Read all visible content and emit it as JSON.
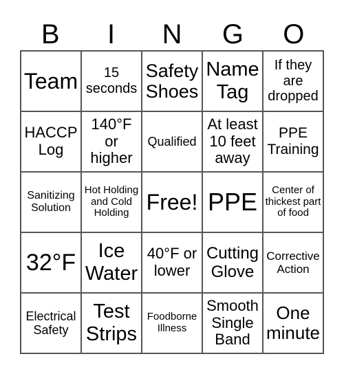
{
  "header": [
    "B",
    "I",
    "N",
    "G",
    "O"
  ],
  "cells": [
    {
      "text": "Team",
      "size": 32
    },
    {
      "text": "15 seconds",
      "size": 20
    },
    {
      "text": "Safety Shoes",
      "size": 27
    },
    {
      "text": "Name Tag",
      "size": 29
    },
    {
      "text": "If they are dropped",
      "size": 20
    },
    {
      "text": "HACCP Log",
      "size": 22
    },
    {
      "text": "140°F or higher",
      "size": 22
    },
    {
      "text": "Qualified",
      "size": 18
    },
    {
      "text": "At least 10 feet away",
      "size": 22
    },
    {
      "text": "PPE Training",
      "size": 21
    },
    {
      "text": "Sanitizing Solution",
      "size": 16
    },
    {
      "text": "Hot Holding and Cold Holding",
      "size": 15
    },
    {
      "text": "Free!",
      "size": 32
    },
    {
      "text": "PPE",
      "size": 36
    },
    {
      "text": "Center of thickest part of food",
      "size": 15
    },
    {
      "text": "32°F",
      "size": 34
    },
    {
      "text": "Ice Water",
      "size": 29
    },
    {
      "text": "40°F or lower",
      "size": 22
    },
    {
      "text": "Cutting Glove",
      "size": 24
    },
    {
      "text": "Corrective Action",
      "size": 17
    },
    {
      "text": "Electrical Safety",
      "size": 18
    },
    {
      "text": "Test Strips",
      "size": 29
    },
    {
      "text": "Foodborne Illness",
      "size": 15
    },
    {
      "text": "Smooth Single Band",
      "size": 22
    },
    {
      "text": "One minute",
      "size": 26
    }
  ]
}
